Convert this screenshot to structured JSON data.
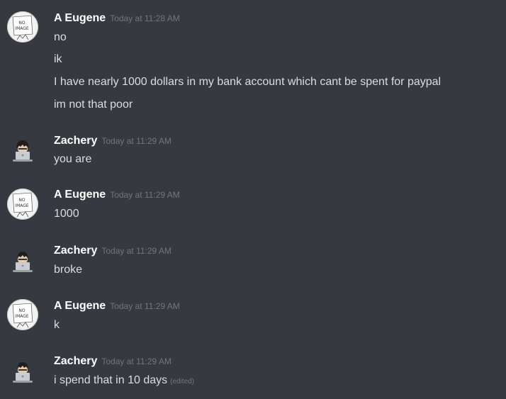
{
  "messages": [
    {
      "author": "A Eugene",
      "avatar": "no-image-avatar",
      "time": "Today at 11:28 AM",
      "lines": [
        "no",
        "ik",
        "I have nearly 1000 dollars in my bank account which cant be spent for paypal",
        "im not that poor"
      ]
    },
    {
      "author": "Zachery",
      "avatar": "laptop-person-avatar",
      "time": "Today at 11:29 AM",
      "lines": [
        "you are"
      ]
    },
    {
      "author": "A Eugene",
      "avatar": "no-image-avatar",
      "time": "Today at 11:29 AM",
      "lines": [
        "1000"
      ]
    },
    {
      "author": "Zachery",
      "avatar": "laptop-person-avatar",
      "time": "Today at 11:29 AM",
      "lines": [
        "broke"
      ]
    },
    {
      "author": "A Eugene",
      "avatar": "no-image-avatar",
      "time": "Today at 11:29 AM",
      "lines": [
        "k"
      ]
    },
    {
      "author": "Zachery",
      "avatar": "laptop-person-avatar",
      "time": "Today at 11:29 AM",
      "lines": [
        "i spend that in 10 days"
      ],
      "edited": "(edited)"
    }
  ],
  "no_image_text": [
    "NO",
    "IMAGE"
  ],
  "colors": {
    "background": "#36393f",
    "username": "#ffffff",
    "text": "#dcddde",
    "muted": "#72767d"
  }
}
